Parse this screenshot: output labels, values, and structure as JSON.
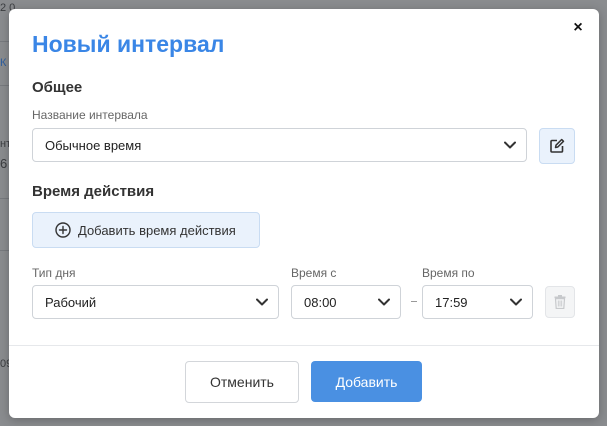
{
  "background": {
    "fragments": [
      "2 0",
      "К",
      "нт",
      "6",
      "09"
    ]
  },
  "modal": {
    "title": "Новый интервал",
    "close_label": "×"
  },
  "general": {
    "section_title": "Общее",
    "name_label": "Название интервала",
    "name_value": "Обычное время"
  },
  "validity": {
    "section_title": "Время действия",
    "add_button_label": "Добавить время действия"
  },
  "row": {
    "day_type_label": "Тип дня",
    "day_type_value": "Рабочий",
    "time_from_label": "Время с",
    "time_from_value": "08:00",
    "time_to_label": "Время по",
    "time_to_value": "17:59"
  },
  "footer": {
    "cancel_label": "Отменить",
    "add_label": "Добавить"
  },
  "colors": {
    "accent": "#4a90e2",
    "title": "#3a86e6",
    "overlay": "#8a8c8f"
  }
}
